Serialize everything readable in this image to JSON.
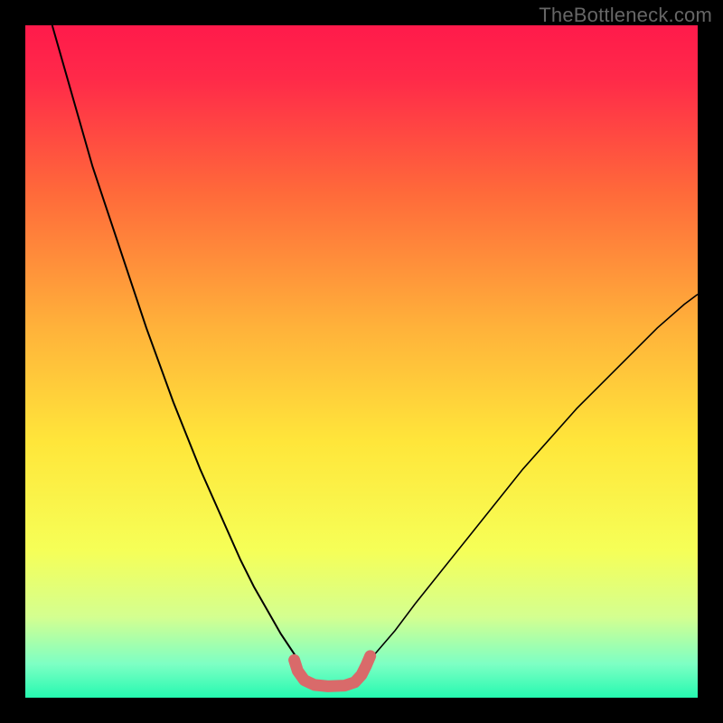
{
  "watermark": "TheBottleneck.com",
  "chart_data": {
    "type": "line",
    "title": "",
    "xlabel": "",
    "ylabel": "",
    "xlim": [
      0,
      100
    ],
    "ylim": [
      0,
      100
    ],
    "background_gradient": {
      "stops": [
        {
          "offset": 0,
          "color": "#ff1a4b"
        },
        {
          "offset": 0.08,
          "color": "#ff2a49"
        },
        {
          "offset": 0.25,
          "color": "#ff6a3a"
        },
        {
          "offset": 0.45,
          "color": "#ffb23a"
        },
        {
          "offset": 0.62,
          "color": "#ffe63a"
        },
        {
          "offset": 0.78,
          "color": "#f6ff57"
        },
        {
          "offset": 0.88,
          "color": "#d4ff90"
        },
        {
          "offset": 0.95,
          "color": "#7DFFC4"
        },
        {
          "offset": 1.0,
          "color": "#25F9B0"
        }
      ]
    },
    "series": [
      {
        "name": "left-branch",
        "color": "#000000",
        "width": 2.0,
        "x": [
          4,
          6,
          8,
          10,
          12,
          14,
          16,
          18,
          20,
          22,
          24,
          26,
          28,
          30,
          32,
          34,
          36,
          38,
          40,
          41
        ],
        "y": [
          100,
          93,
          86,
          79,
          73,
          67,
          61,
          55,
          49.5,
          44,
          39,
          34,
          29.5,
          25,
          20.5,
          16.5,
          13,
          9.5,
          6.5,
          4.5
        ]
      },
      {
        "name": "right-branch",
        "color": "#000000",
        "width": 1.6,
        "x": [
          50,
          52,
          55,
          58,
          62,
          66,
          70,
          74,
          78,
          82,
          86,
          90,
          94,
          98,
          100
        ],
        "y": [
          4.5,
          6.5,
          10,
          14,
          19,
          24,
          29,
          34,
          38.5,
          43,
          47,
          51,
          55,
          58.5,
          60
        ]
      },
      {
        "name": "valley-highlight",
        "color": "#d96a6a",
        "width": 13,
        "linecap": "round",
        "x": [
          40.0,
          40.5,
          41.5,
          43.0,
          45.0,
          47.5,
          49.0,
          50.0,
          50.7,
          51.3
        ],
        "y": [
          5.6,
          4.0,
          2.6,
          1.9,
          1.7,
          1.8,
          2.3,
          3.4,
          4.8,
          6.2
        ]
      }
    ]
  }
}
